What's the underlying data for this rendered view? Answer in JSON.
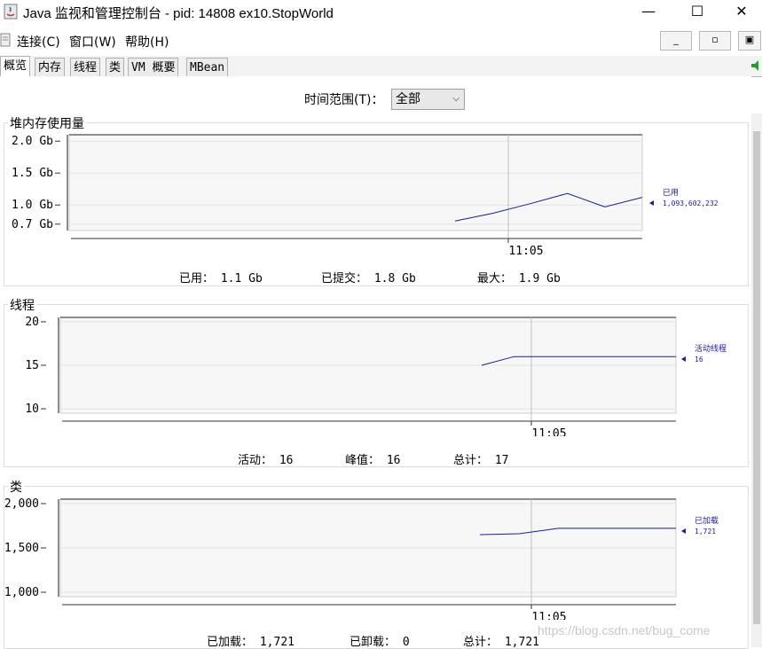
{
  "window": {
    "title": "Java 监视和管理控制台 - pid: 14808 ex10.StopWorld",
    "minimize": "—",
    "maximize": "☐",
    "close": "✕"
  },
  "menu": {
    "items": [
      "连接(C)",
      "窗口(W)",
      "帮助(H)"
    ],
    "mdi": [
      "_",
      "▫",
      "▣"
    ]
  },
  "tabs": [
    "概览",
    "内存",
    "线程",
    "类",
    "VM 概要",
    "MBean"
  ],
  "time_range": {
    "label": "时间范围(T)：",
    "value": "全部"
  },
  "watermark": "https://blog.csdn.net/bug_come",
  "colors": {
    "series": "#1a1aa6",
    "grid": "#e3e3e3",
    "plot_bg": "#f7f7f7"
  },
  "chart_data": [
    {
      "type": "line",
      "title": "堆内存使用量",
      "yticks": [
        "2.0 Gb",
        "1.5 Gb",
        "1.0 Gb",
        "0.7 Gb"
      ],
      "ytick_values": [
        2.0,
        1.5,
        1.0,
        0.7
      ],
      "ylim": [
        0.6,
        2.1
      ],
      "xtick": "11:05",
      "series": [
        {
          "name": "已用",
          "values": [
            0.75,
            0.87,
            1.02,
            1.18,
            0.97,
            1.12
          ],
          "latest": "1,093,602,232"
        }
      ],
      "stats": [
        {
          "label": "已用：",
          "value": "1.1  Gb"
        },
        {
          "label": "已提交：",
          "value": "1.8  Gb"
        },
        {
          "label": "最大：",
          "value": "1.9  Gb"
        }
      ]
    },
    {
      "type": "line",
      "title": "线程",
      "yticks": [
        "20",
        "15",
        "10"
      ],
      "ytick_values": [
        20,
        15,
        10
      ],
      "ylim": [
        9.5,
        20.5
      ],
      "xtick": "11:05",
      "series": [
        {
          "name": "活动线程",
          "values": [
            15,
            16,
            16,
            16,
            16,
            16,
            16
          ],
          "latest": "16"
        }
      ],
      "stats": [
        {
          "label": "活动：",
          "value": "16"
        },
        {
          "label": "峰值：",
          "value": "16"
        },
        {
          "label": "总计：",
          "value": "17"
        }
      ]
    },
    {
      "type": "line",
      "title": "类",
      "yticks": [
        "2,000",
        "1,500",
        "1,000"
      ],
      "ytick_values": [
        2000,
        1500,
        1000
      ],
      "ylim": [
        950,
        2050
      ],
      "xtick": "11:05",
      "series": [
        {
          "name": "已加载",
          "values": [
            1650,
            1660,
            1721,
            1721,
            1721,
            1721
          ],
          "latest": "1,721"
        }
      ],
      "stats": [
        {
          "label": "已加载：",
          "value": "1,721"
        },
        {
          "label": "已卸载：",
          "value": "0"
        },
        {
          "label": "总计：",
          "value": "1,721"
        }
      ]
    }
  ]
}
